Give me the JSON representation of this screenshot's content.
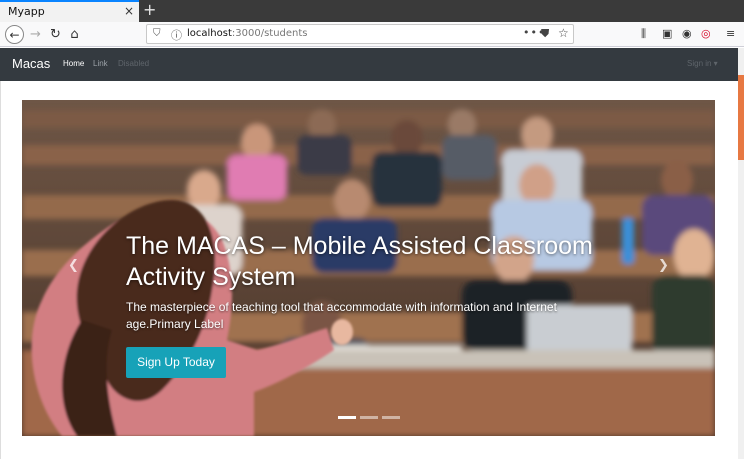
{
  "browser": {
    "tab_title": "Myapp",
    "tab_close": "×",
    "new_tab": "+",
    "url_host": "localhost",
    "url_path": ":3000/students",
    "url_dots": "•••"
  },
  "navbar": {
    "brand": "Macas",
    "links": [
      {
        "label": "Home"
      },
      {
        "label": "Link"
      },
      {
        "label": "Disabled"
      }
    ],
    "signin": "Sign in ▾"
  },
  "carousel": {
    "title": "The MACAS – Mobile Assisted Classroom Activity System",
    "subtitle": "The masterpiece of teaching tool that accommodate with information and Internet age.Primary Label",
    "cta_label": "Sign Up Today",
    "prev_icon": "chevron-left",
    "next_icon": "chevron-right",
    "slide_count": 3,
    "active_slide": 1
  },
  "colors": {
    "navbar_bg": "#343a40",
    "cta_bg": "#17a2b8",
    "scroll_thumb": "#e77842"
  }
}
